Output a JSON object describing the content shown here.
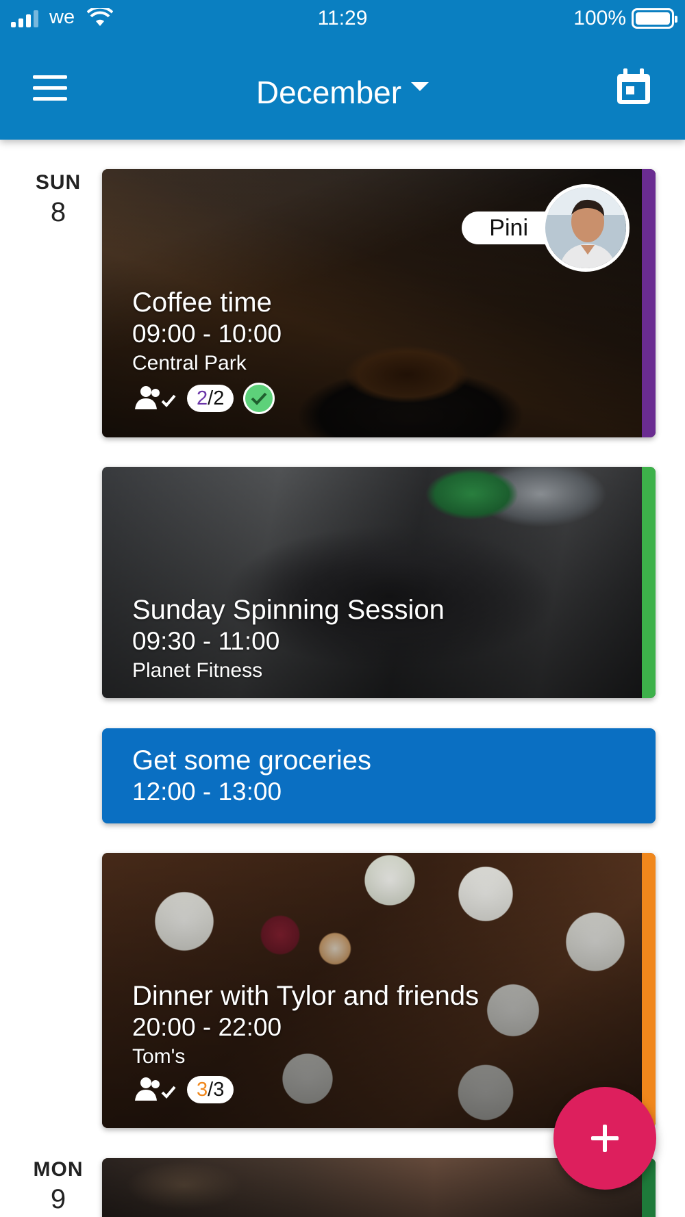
{
  "status_bar": {
    "carrier": "we",
    "time": "11:29",
    "battery": "100%"
  },
  "header": {
    "month": "December",
    "menu_icon": "hamburger-icon",
    "calendar_icon": "calendar-icon"
  },
  "days": [
    {
      "dow": "SUN",
      "num": "8"
    },
    {
      "dow": "MON",
      "num": "9"
    }
  ],
  "events": [
    {
      "title": "Coffee time",
      "time": "09:00 - 10:00",
      "location": "Central Park",
      "host": "Pini",
      "attendance": {
        "accepted": "2",
        "total": "2"
      },
      "accepted_color": "#6a35a8",
      "accent": "#6a2c91"
    },
    {
      "title": "Sunday Spinning Session",
      "time": "09:30 - 11:00",
      "location": "Planet Fitness",
      "accent": "#3db14a"
    },
    {
      "title": "Get some groceries",
      "time": "12:00 - 13:00",
      "accent": "#0a6fc2"
    },
    {
      "title": "Dinner with Tylor and friends",
      "time": "20:00 - 22:00",
      "location": "Tom's",
      "attendance": {
        "accepted": "3",
        "total": "3"
      },
      "accepted_color": "#f0871c",
      "accent": "#f0871c"
    },
    {
      "accent": "#1e7a3a"
    }
  ],
  "fab": {
    "icon": "plus-icon"
  }
}
